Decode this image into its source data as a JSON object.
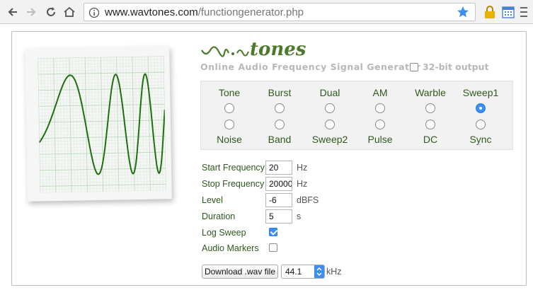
{
  "browser": {
    "url_host": "www.wavtones.com",
    "url_path": "/functiongenerator.php"
  },
  "header": {
    "logo_text": "tones",
    "subtitle": "Online Audio Frequency Signal Generator",
    "bit_option": {
      "label": "32-bit output",
      "checked": false
    }
  },
  "waveforms": [
    {
      "top": "Tone",
      "bottom": "Noise",
      "top_checked": false,
      "bottom_checked": false
    },
    {
      "top": "Burst",
      "bottom": "Band",
      "top_checked": false,
      "bottom_checked": false
    },
    {
      "top": "Dual",
      "bottom": "Sweep2",
      "top_checked": false,
      "bottom_checked": false
    },
    {
      "top": "AM",
      "bottom": "Pulse",
      "top_checked": false,
      "bottom_checked": false
    },
    {
      "top": "Warble",
      "bottom": "DC",
      "top_checked": false,
      "bottom_checked": false
    },
    {
      "top": "Sweep1",
      "bottom": "Sync",
      "top_checked": true,
      "bottom_checked": false
    }
  ],
  "params": {
    "start_frequency": {
      "label": "Start Frequency",
      "value": "20",
      "unit": "Hz"
    },
    "stop_frequency": {
      "label": "Stop Frequency",
      "value": "20000",
      "unit": "Hz"
    },
    "level": {
      "label": "Level",
      "value": "-6",
      "unit": "dBFS"
    },
    "duration": {
      "label": "Duration",
      "value": "5",
      "unit": "s"
    },
    "log_sweep": {
      "label": "Log Sweep",
      "checked": true
    },
    "audio_markers": {
      "label": "Audio Markers",
      "checked": false
    }
  },
  "download": {
    "button_label": "Download .wav file",
    "sample_rate": "44.1",
    "sample_rate_unit": "kHz"
  },
  "colors": {
    "accent_blue": "#3b8ff0",
    "label_green": "#2f5a1d",
    "wave_green": "#1f6e10"
  }
}
